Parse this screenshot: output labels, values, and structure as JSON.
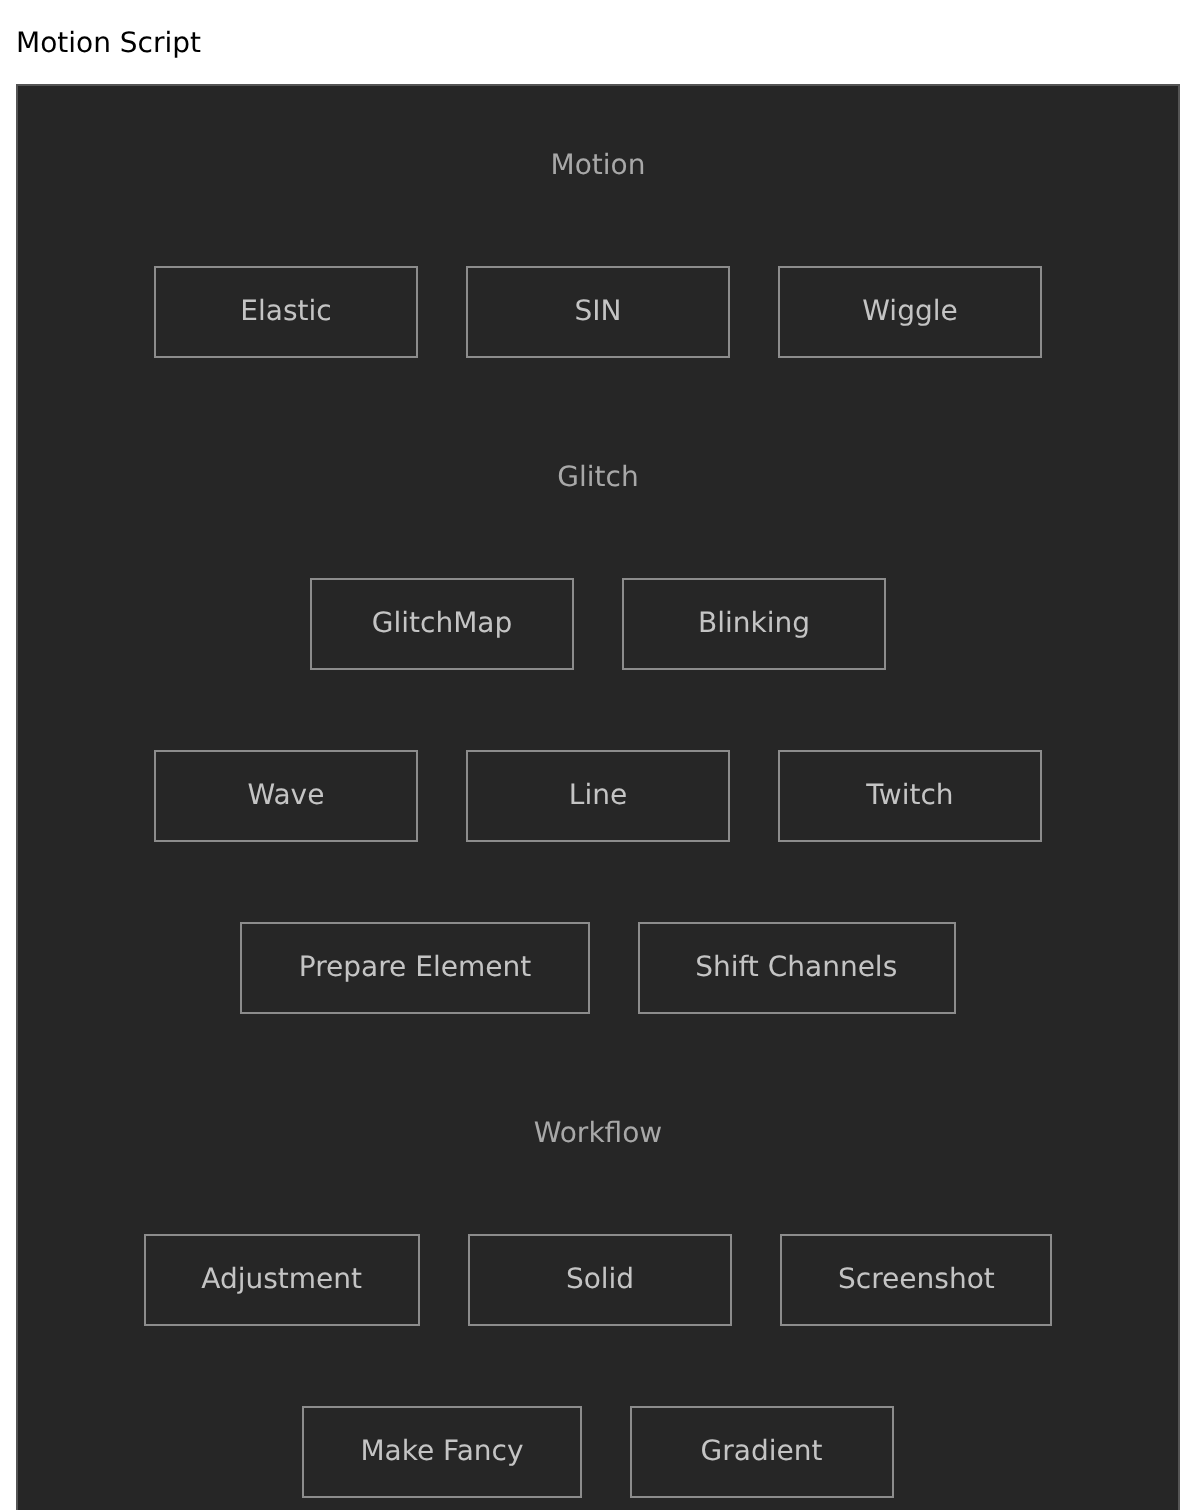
{
  "window": {
    "title": "Motion Script"
  },
  "sections": [
    {
      "heading": "Motion",
      "rows": [
        [
          "Elastic",
          "SIN",
          "Wiggle"
        ]
      ]
    },
    {
      "heading": "Glitch",
      "rows": [
        [
          "GlitchMap",
          "Blinking"
        ],
        [
          "Wave",
          "Line",
          "Twitch"
        ],
        [
          "Prepare Element",
          "Shift Channels"
        ]
      ]
    },
    {
      "heading": "Workflow",
      "rows": [
        [
          "Adjustment",
          "Solid",
          "Screenshot"
        ],
        [
          "Make Fancy",
          "Gradient"
        ]
      ]
    }
  ]
}
